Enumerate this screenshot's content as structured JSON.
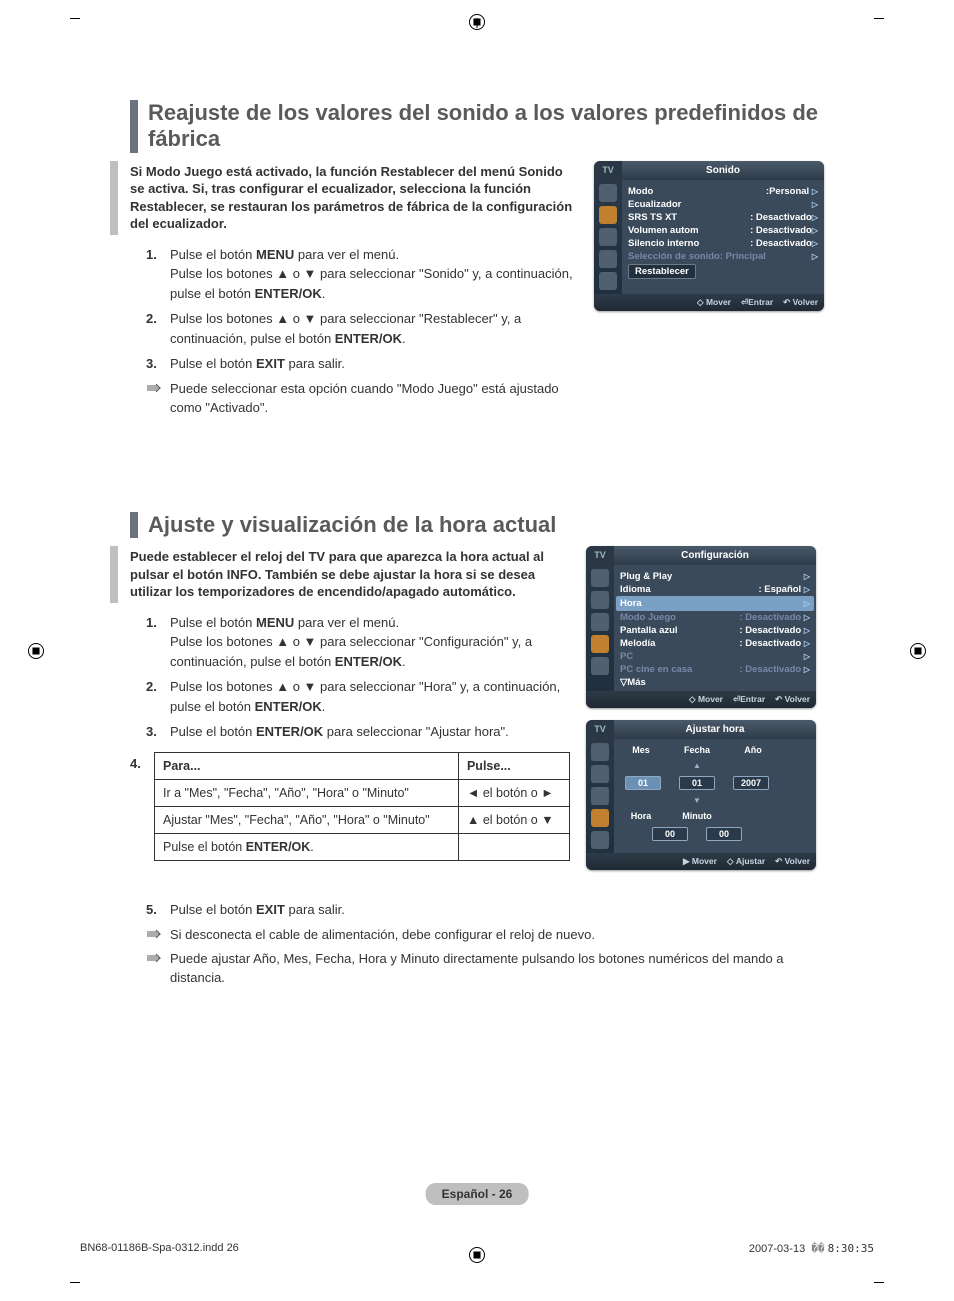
{
  "section1": {
    "title": "Reajuste de los valores del sonido a los valores predefinidos de fábrica",
    "intro": "Si Modo Juego está activado, la función Restablecer del menú Sonido se activa. Si, tras configurar el ecualizador, selecciona la función Restablecer, se restauran los parámetros de fábrica de la configuración del ecualizador.",
    "step1a": "Pulse el botón ",
    "step1b": " para ver el menú.",
    "step1c": "Pulse los botones ▲ o ▼ para seleccionar \"Sonido\" y, a continuación, pulse el botón ",
    "step2a": "Pulse los botones ▲ o ▼ para seleccionar \"Restablecer\" y, a continuación, pulse el botón ",
    "step3a": "Pulse el botón ",
    "step3b": " para salir.",
    "note1": "Puede seleccionar esta opción cuando \"Modo Juego\" está ajustado como \"Activado\".",
    "menu_label": "MENU",
    "enter_label": "ENTER/OK",
    "exit_label": "EXIT"
  },
  "osd1": {
    "tv": "TV",
    "title": "Sonido",
    "r1": "Modo",
    "v1": ":Personal",
    "r2": "Ecualizador",
    "r3": "SRS TS XT",
    "v3": ": Desactivado",
    "r4": "Volumen autom",
    "v4": ": Desactivado",
    "r5": "Silencio interno",
    "v5": ": Desactivado",
    "r6": "Selección de sonido: Principal",
    "r7": "Restablecer",
    "f1": "Mover",
    "f2": "Entrar",
    "f3": "Volver"
  },
  "section2": {
    "title": "Ajuste y visualización de la hora actual",
    "intro": "Puede establecer el reloj del TV para que aparezca la hora actual al pulsar el botón INFO. También se debe ajustar la hora si se desea utilizar los temporizadores de encendido/apagado automático.",
    "step1a": "Pulse el botón ",
    "step1b": " para ver el menú.",
    "step1c": "Pulse los botones ▲ o ▼ para seleccionar \"Configuración\" y, a continuación, pulse el botón ",
    "step2a": "Pulse los botones ▲ o ▼ para seleccionar \"Hora\" y, a continuación, pulse el botón ",
    "step3a": "Pulse el botón ",
    "step3b": " para seleccionar \"Ajustar hora\".",
    "step5a": "Pulse el botón ",
    "step5b": " para salir.",
    "note1": "Si desconecta el cable de alimentación, debe configurar el reloj de nuevo.",
    "note2": "Puede ajustar Año, Mes, Fecha, Hora y Minuto directamente pulsando los botones numéricos del mando a distancia.",
    "th1": "Para...",
    "th2": "Pulse...",
    "r1c1": "Ir a \"Mes\", \"Fecha\", \"Año\", \"Hora\" o \"Minuto\"",
    "r1c2": "◄ el botón  o ►",
    "r2c1": "Ajustar \"Mes\", \"Fecha\", \"Año\", \"Hora\" o \"Minuto\"",
    "r2c2": "▲ el botón  o ▼",
    "r3c1a": "Pulse el botón ",
    "menu_label": "MENU",
    "enter_label": "ENTER/OK",
    "exit_label": "EXIT"
  },
  "osd2": {
    "tv": "TV",
    "title": "Configuración",
    "r1": "Plug & Play",
    "r2": "Idioma",
    "v2": ": Español",
    "r3": "Hora",
    "r4": "Modo Juego",
    "v4": ": Desactivado",
    "r5": "Pantalla azul",
    "v5": ": Desactivado",
    "r6": "Melodía",
    "v6": ": Desactivado",
    "r7": "PC",
    "r8": "PC cine en casa",
    "v8": ": Desactivado",
    "r9": "▽Más",
    "f1": "Mover",
    "f2": "Entrar",
    "f3": "Volver"
  },
  "osd3": {
    "tv": "TV",
    "title": "Ajustar hora",
    "l1": "Mes",
    "l2": "Fecha",
    "l3": "Año",
    "b1": "01",
    "b2": "01",
    "b3": "2007",
    "l4": "Hora",
    "l5": "Minuto",
    "b4": "00",
    "b5": "00",
    "f1": "Mover",
    "f2": "Ajustar",
    "f3": "Volver"
  },
  "page_footer": "Español - 26",
  "print": {
    "file": "BN68-01186B-Spa-0312.indd   26",
    "date": "2007-03-13",
    "time": "8:30:35",
    "sep": "��"
  }
}
